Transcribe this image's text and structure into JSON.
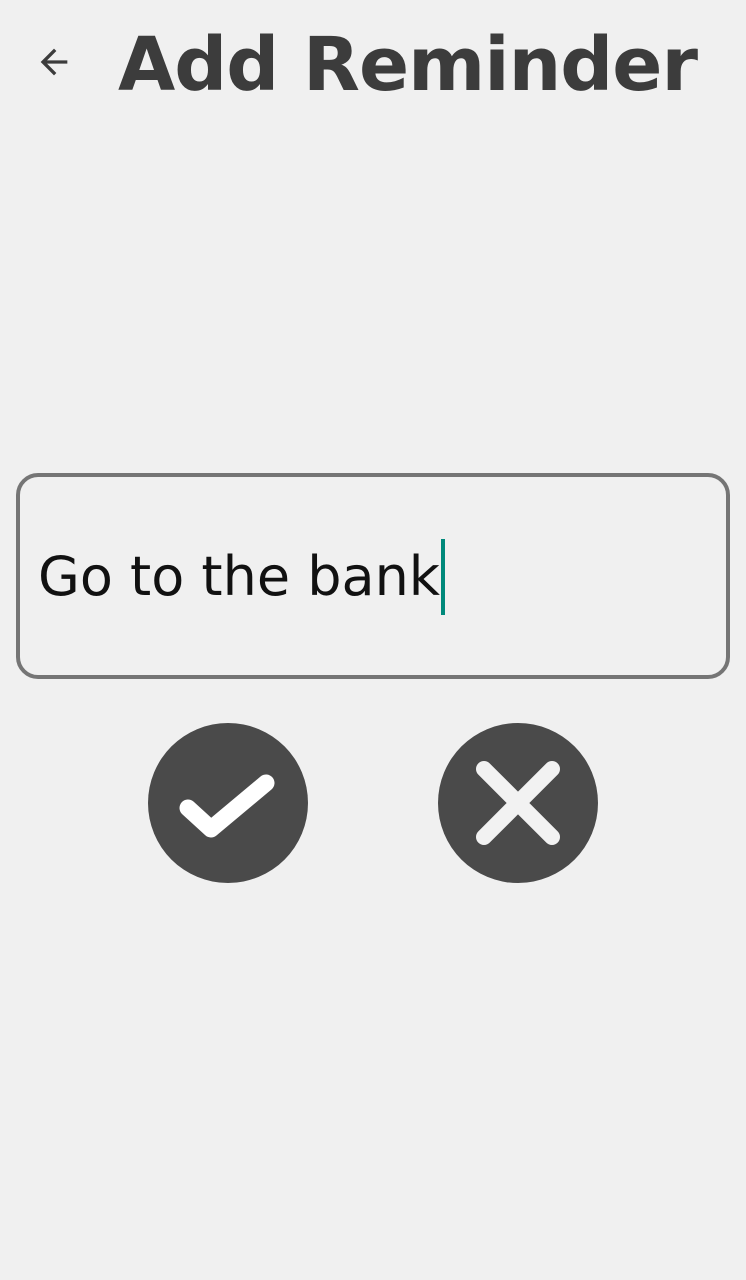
{
  "header": {
    "title": "Add Reminder",
    "back_icon": "arrow-back-icon"
  },
  "form": {
    "reminder_value": "Go to the bank"
  },
  "actions": {
    "confirm_icon": "checkmark-icon",
    "cancel_icon": "close-icon"
  },
  "colors": {
    "background": "#f0f0f0",
    "title": "#3c3c3c",
    "field_border": "#757575",
    "button": "#4a4a4a",
    "cursor": "#00897b"
  }
}
